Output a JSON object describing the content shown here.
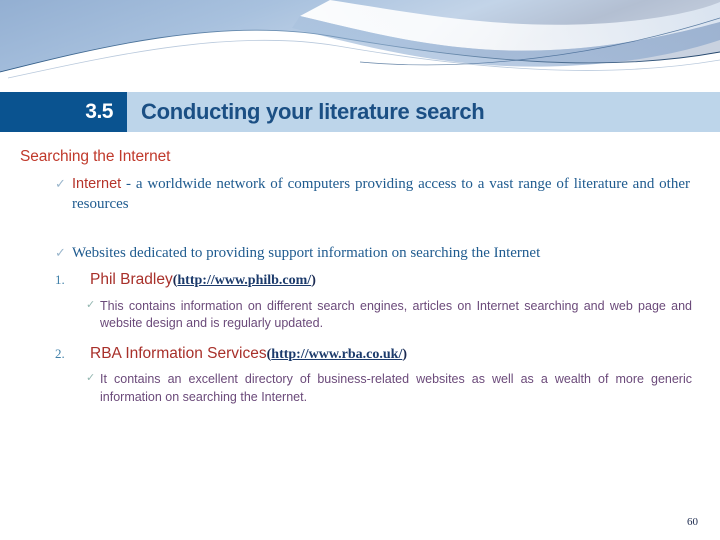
{
  "slide": {
    "title_number": "3.5",
    "title_text": "Conducting your literature search",
    "page_number": "60",
    "colors": {
      "band_dark_blue": "#0a5390",
      "band_light_blue": "#bdd5ea",
      "title_text": "#1b4f84",
      "heading_red": "#c0392b",
      "body_blue": "#1f5b8f",
      "accent_red": "#a8302a",
      "sub_purple": "#6b4a7a",
      "tick_gray_blue": "#9ab6cc"
    }
  },
  "content": {
    "section_heading": "Searching the Internet",
    "bullet_one": {
      "tick": "✓",
      "lead": "Internet",
      "rest": " - a worldwide network of computers providing access to a vast range of literature and other resources"
    },
    "bullet_two": {
      "tick": "✓",
      "text": "Websites dedicated to providing support information on searching the Internet"
    },
    "items": [
      {
        "number": "1.",
        "name": "Phil Bradley",
        "paren_open": "(",
        "url": "http://www.philb.com/",
        "paren_close": ")",
        "sub": {
          "tick": "✓",
          "text": "This contains information on different search engines, articles on Internet searching and web page and website design and is regularly updated."
        }
      },
      {
        "number": "2.",
        "name": "RBA Information Services",
        "paren_open": "(",
        "url": "http://www.rba.co.uk/",
        "paren_close": ")",
        "sub": {
          "tick": "✓",
          "text": "It contains an excellent directory of business-related websites as well as a wealth of more generic information on searching the Internet."
        }
      }
    ]
  }
}
